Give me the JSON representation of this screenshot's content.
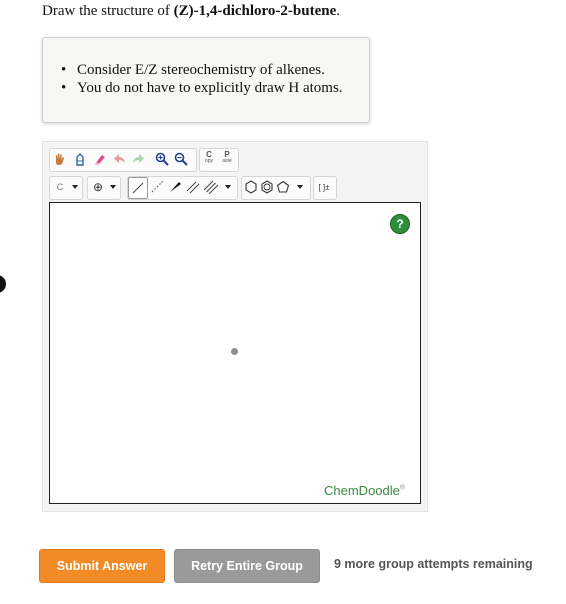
{
  "question": {
    "prefix": "Draw the structure of ",
    "compound": "(Z)-1,4-dichloro-2-butene",
    "suffix": "."
  },
  "hints": [
    "Consider E/Z stereochemistry of alkenes.",
    "You do not have to explicitly draw H atoms."
  ],
  "toolbar": {
    "copy_label_top": "C",
    "copy_label_bottom": "opy",
    "paste_label_top": "P",
    "paste_label_bottom": "aste",
    "atom_label": "C",
    "charge_label": "⊕",
    "bracket_label": "[ ]±"
  },
  "editor": {
    "help_label": "?",
    "brand": "ChemDoodle",
    "brand_mark": "®"
  },
  "actions": {
    "submit_label": "Submit Answer",
    "retry_label": "Retry Entire Group",
    "attempts_text": "9 more group attempts remaining"
  },
  "colors": {
    "submit": "#f28a25",
    "retry": "#9a9a9a",
    "brand": "#3a8a43"
  }
}
